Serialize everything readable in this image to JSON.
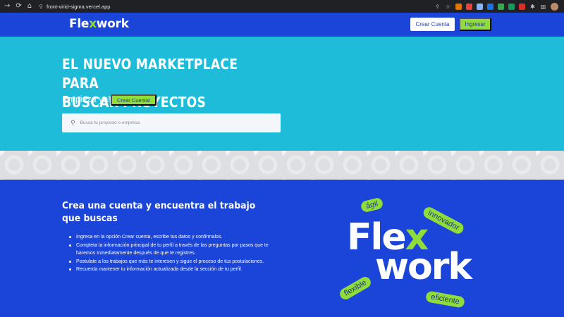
{
  "browser": {
    "url": "front-virid-sigma.vercel.app",
    "nav_icons": [
      "arrow-forward-icon",
      "reload-icon",
      "home-icon"
    ],
    "extension_colors": [
      "#5f6368",
      "#e37400",
      "#ea4335",
      "#1a73e8",
      "#8ab4f8",
      "#5f6368",
      "#34a853",
      "#0f9d58",
      "#d93025",
      "#9aa0a6"
    ]
  },
  "header": {
    "logo_prefix": "Fle",
    "logo_x": "x",
    "logo_suffix": "work",
    "create_account": "Crear Cuenta",
    "login": "Ingresar"
  },
  "hero": {
    "title_line1": "EL NUEVO MARKETPLACE PARA",
    "title_line2": "BUSCAR PROYECTOS",
    "subtitle": "Empieza ya!",
    "cta": "Crear Cuenta!",
    "search_placeholder": "Busca tu proyecto o empresa"
  },
  "main": {
    "title": "Crea una cuenta y encuentra el trabajo que buscas",
    "steps": [
      "Ingresa en la opción Crear cuenta, escribe tus datos y confirmalos.",
      "Completa la información principal de tu perfil a través de las preguntas por pasos que te haremos Inmediatamente después de que te registres.",
      "Postulate a los trabajos que más te interesen y sigue el proceso de tus postulaciones.",
      "Recuerda mantener tu información actualizada desde la sección de tu perfil."
    ]
  },
  "brand_graphic": {
    "line1_prefix": "Fle",
    "line1_x": "x",
    "line2": "work",
    "tags": [
      "ágil",
      "innovador",
      "flexible",
      "eficiente"
    ]
  },
  "colors": {
    "primary_blue": "#1a45d8",
    "hero_cyan": "#1ebcd8",
    "accent_green": "#8fdc3a"
  }
}
